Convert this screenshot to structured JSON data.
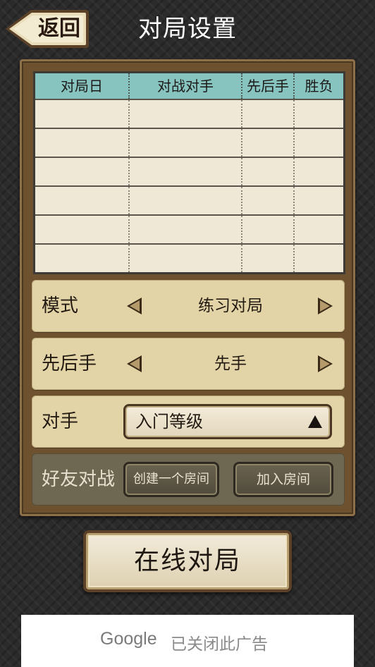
{
  "header": {
    "back_label": "返回",
    "title": "对局设置"
  },
  "history_table": {
    "columns": [
      "对局日",
      "对战对手",
      "先后手",
      "胜负"
    ],
    "rows": [
      [
        "",
        "",
        "",
        ""
      ],
      [
        "",
        "",
        "",
        ""
      ],
      [
        "",
        "",
        "",
        ""
      ],
      [
        "",
        "",
        "",
        ""
      ],
      [
        "",
        "",
        "",
        ""
      ],
      [
        "",
        "",
        "",
        ""
      ]
    ]
  },
  "settings": {
    "mode": {
      "label": "模式",
      "value": "练习对局"
    },
    "turn_order": {
      "label": "先后手",
      "value": "先手"
    },
    "opponent": {
      "label": "对手",
      "value": "入门等级"
    },
    "friend_match": {
      "label": "好友对战",
      "create_room_label": "创建一个房间",
      "join_room_label": "加入房间"
    }
  },
  "online_button_label": "在线对局",
  "ad": {
    "logo_text": "Google",
    "closed_text": "已关闭此广告"
  },
  "colors": {
    "panel_brown": "#6e5230",
    "row_beige": "#e3d4a8",
    "table_header_teal": "#88c4bf",
    "table_body": "#efe8d6",
    "friend_row": "#6e6751"
  },
  "icons": {
    "back": "back-arrow-icon",
    "left_arrow": "triangle-left-icon",
    "right_arrow": "triangle-right-icon",
    "caret": "triangle-up-icon"
  }
}
